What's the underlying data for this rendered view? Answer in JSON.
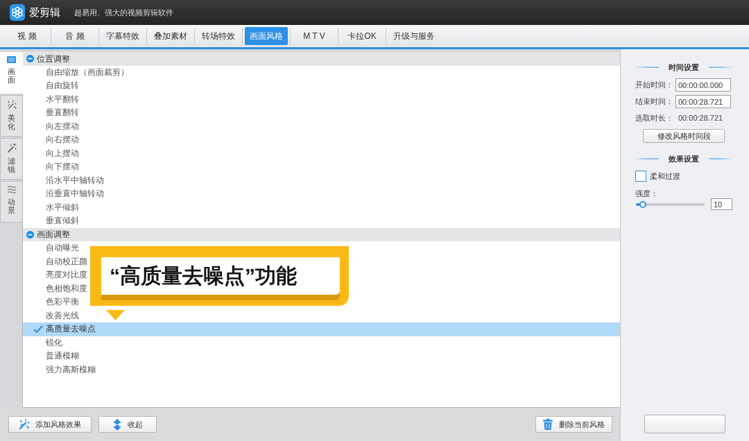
{
  "app": {
    "name": "爱剪辑",
    "tagline": "超易用、强大的视频剪辑软件"
  },
  "tabs": [
    {
      "label": "视 频",
      "selected": false
    },
    {
      "label": "音 频",
      "selected": false
    },
    {
      "label": "字幕特效",
      "selected": false
    },
    {
      "label": "叠加素材",
      "selected": false
    },
    {
      "label": "转场特效",
      "selected": false
    },
    {
      "label": "画面风格",
      "selected": true
    },
    {
      "label": "M T V",
      "selected": false
    },
    {
      "label": "卡拉OK",
      "selected": false
    },
    {
      "label": "升级与服务",
      "selected": false
    }
  ],
  "side_tabs": [
    {
      "label": "画面",
      "selected": true
    },
    {
      "label": "美化",
      "selected": false
    },
    {
      "label": "滤镜",
      "selected": false
    },
    {
      "label": "动景",
      "selected": false
    }
  ],
  "effect_groups": [
    {
      "label": "位置调整",
      "expanded": true,
      "items": [
        {
          "label": "自由缩放（画面裁剪）",
          "selected": false
        },
        {
          "label": "自由旋转",
          "selected": false
        },
        {
          "label": "水平翻转",
          "selected": false
        },
        {
          "label": "垂直翻转",
          "selected": false
        },
        {
          "label": "向左摆动",
          "selected": false
        },
        {
          "label": "向右摆动",
          "selected": false
        },
        {
          "label": "向上摆动",
          "selected": false
        },
        {
          "label": "向下摆动",
          "selected": false
        },
        {
          "label": "沿水平中轴转动",
          "selected": false
        },
        {
          "label": "沿垂直中轴转动",
          "selected": false
        },
        {
          "label": "水平倾斜",
          "selected": false
        },
        {
          "label": "垂直倾斜",
          "selected": false
        }
      ]
    },
    {
      "label": "画面调整",
      "expanded": true,
      "items": [
        {
          "label": "自动曝光",
          "selected": false
        },
        {
          "label": "自动校正颜",
          "selected": false
        },
        {
          "label": "亮度对比度",
          "selected": false
        },
        {
          "label": "色相饱和度",
          "selected": false
        },
        {
          "label": "色彩平衡",
          "selected": false
        },
        {
          "label": "改善光线",
          "selected": false
        },
        {
          "label": "高质量去噪点",
          "selected": true
        },
        {
          "label": "锐化",
          "selected": false
        },
        {
          "label": "普通模糊",
          "selected": false
        },
        {
          "label": "强力高斯模糊",
          "selected": false
        }
      ]
    }
  ],
  "callout": {
    "text": "“高质量去噪点”功能"
  },
  "bottom_bar": {
    "left": [
      "添加风格效果",
      "收起"
    ],
    "right": [
      "删除当前风格"
    ]
  },
  "time_settings": {
    "title": "时间设置",
    "start": {
      "label": "开始时间：",
      "value": "00:00:00.000"
    },
    "end": {
      "label": "结束时间：",
      "value": "00:00:28.721"
    },
    "duration": {
      "label": "选取时长：",
      "value": "00:00:28.721"
    },
    "button": "修改风格时间段"
  },
  "effect_settings": {
    "title": "效果设置",
    "soft_transition": {
      "label": "柔和过渡",
      "checked": false
    },
    "strength": {
      "label": "强度：",
      "level": 0.1,
      "value": "10"
    }
  }
}
